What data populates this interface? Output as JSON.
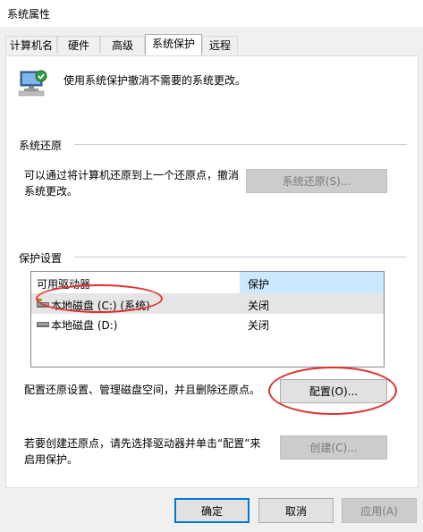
{
  "window": {
    "title": "系统属性"
  },
  "tabs": [
    {
      "label": "计算机名",
      "active": false
    },
    {
      "label": "硬件",
      "active": false
    },
    {
      "label": "高级",
      "active": false
    },
    {
      "label": "系统保护",
      "active": true
    },
    {
      "label": "远程",
      "active": false
    }
  ],
  "header": {
    "icon": "system-protection-icon",
    "text": "使用系统保护撤消不需要的系统更改。"
  },
  "restore": {
    "title": "系统还原",
    "desc_line1": "可以通过将计算机还原到上一个还原点，撤消",
    "desc_line2": "系统更改。",
    "button": "系统还原(S)..."
  },
  "protection": {
    "title": "保护设置",
    "columns": [
      "可用驱动器",
      "保护"
    ],
    "drives": [
      {
        "name": "本地磁盘 (C:) (系统)",
        "status": "关闭",
        "icon": "system-drive-icon",
        "selected": true
      },
      {
        "name": "本地磁盘 (D:)",
        "status": "关闭",
        "icon": "drive-icon",
        "selected": false
      }
    ],
    "configure_desc": "配置还原设置、管理磁盘空间，并且删除还原点。",
    "configure_button": "配置(O)...",
    "create_desc_line1": "若要创建还原点，请先选择驱动器并单击“配置”来",
    "create_desc_line2": "启用保护。",
    "create_button": "创建(C)..."
  },
  "footer": {
    "ok": "确定",
    "cancel": "取消",
    "apply": "应用(A)"
  },
  "colors": {
    "annotation": "#e0312f",
    "accent": "#0078d7",
    "header_highlight": "#cce8ff"
  }
}
